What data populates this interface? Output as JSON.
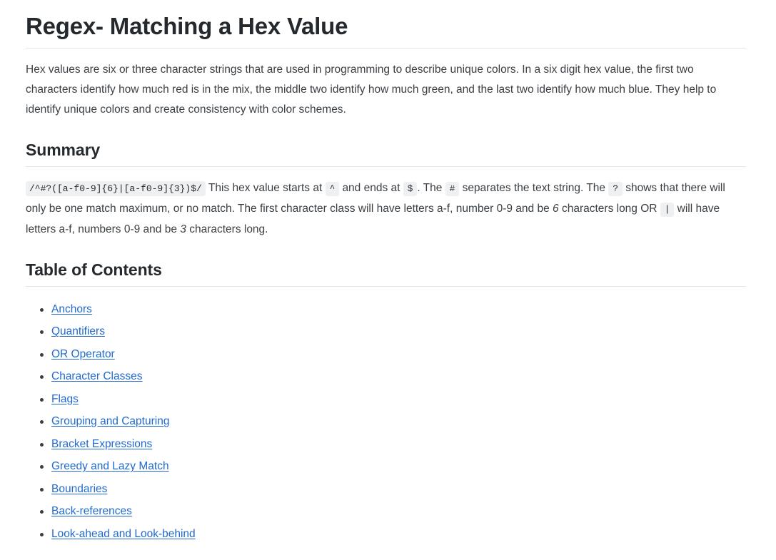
{
  "document": {
    "title": "Regex- Matching a Hex Value",
    "intro_paragraph": "Hex values are six or three character strings that are used in programming to describe unique colors. In a six digit hex value, the first two characters identify how much red is in the mix, the middle two identify how much green, and the last two identify how much blue. They help to identify unique colors and create consistency with color schemes."
  },
  "summary": {
    "heading": "Summary",
    "regex": "/^#?([a-f0-9]{6}|[a-f0-9]{3})$/",
    "text_1": "This hex value starts at",
    "code_caret": "^",
    "text_2": "and ends at",
    "code_dollar": "$",
    "text_3": ". The",
    "code_hash": "#",
    "text_4": "separates the text string. The",
    "code_question": "?",
    "text_5": "shows that there will only be one match maximum, or no match. The first character class will have letters a-f, number 0-9 and be",
    "emphasis_six": "6",
    "text_6": "characters long OR",
    "code_pipe": "|",
    "text_7": "will have letters a-f, numbers 0-9 and be",
    "emphasis_three": "3",
    "text_8": "characters long."
  },
  "table_of_contents": {
    "heading": "Table of Contents",
    "items": [
      {
        "label": "Anchors"
      },
      {
        "label": "Quantifiers"
      },
      {
        "label": "OR Operator"
      },
      {
        "label": "Character Classes"
      },
      {
        "label": "Flags"
      },
      {
        "label": "Grouping and Capturing"
      },
      {
        "label": "Bracket Expressions"
      },
      {
        "label": "Greedy and Lazy Match"
      },
      {
        "label": "Boundaries"
      },
      {
        "label": "Back-references"
      },
      {
        "label": "Look-ahead and Look-behind"
      }
    ]
  },
  "colors": {
    "link": "#2269cf",
    "heading": "#24292e",
    "body_text": "#3a3f44",
    "code_background": "#eef0f2",
    "divider": "#e3e5e8",
    "page_background": "#ffffff"
  }
}
